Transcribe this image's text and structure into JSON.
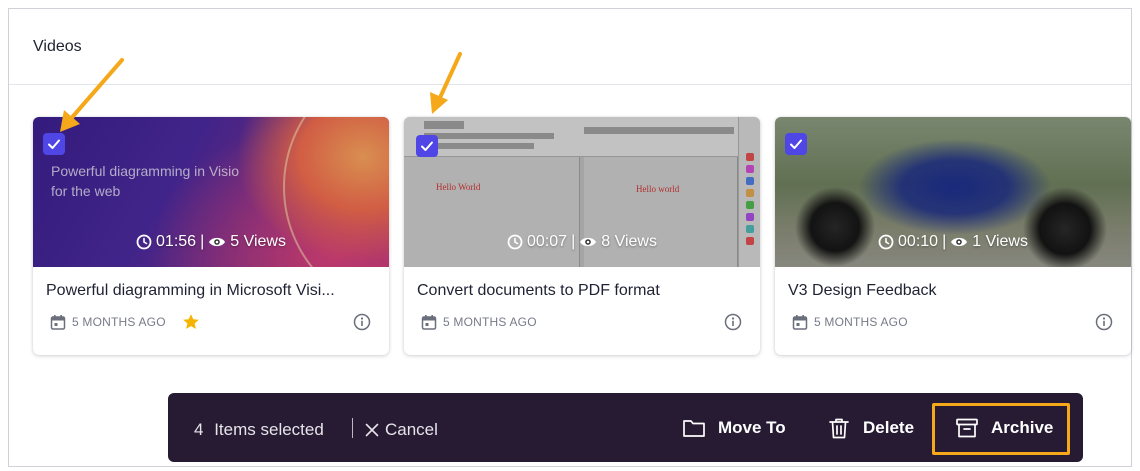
{
  "panel": {
    "title": "Videos"
  },
  "cards": [
    {
      "title": "Powerful diagramming in Microsoft Visi...",
      "thumbnail_text": "Powerful diagramming in Visio for the web",
      "duration": "01:56",
      "views": "5 Views",
      "date": "5 MONTHS AGO",
      "selected": true,
      "starred": true
    },
    {
      "title": "Convert documents to PDF format",
      "doc_text_left": "Hello World",
      "doc_text_right": "Hello world",
      "duration": "00:07",
      "views": "8 Views",
      "date": "5 MONTHS AGO",
      "selected": true,
      "starred": false
    },
    {
      "title": "V3 Design Feedback",
      "duration": "00:10",
      "views": "1 Views",
      "date": "5 MONTHS AGO",
      "selected": true,
      "starred": false
    }
  ],
  "stat_separator": "|",
  "action_bar": {
    "count": "4",
    "count_label": "Items selected",
    "cancel_label": "Cancel",
    "move_label": "Move To",
    "delete_label": "Delete",
    "archive_label": "Archive"
  },
  "colors": {
    "checkbox": "#4f46e5",
    "action_bar_bg": "#261b33",
    "highlight": "#f4a81a",
    "star": "#f5b400"
  },
  "icons": [
    "check-icon",
    "clock-icon",
    "eye-icon",
    "calendar-icon",
    "star-icon",
    "info-icon",
    "close-icon",
    "folder-icon",
    "trash-icon",
    "archive-icon"
  ]
}
